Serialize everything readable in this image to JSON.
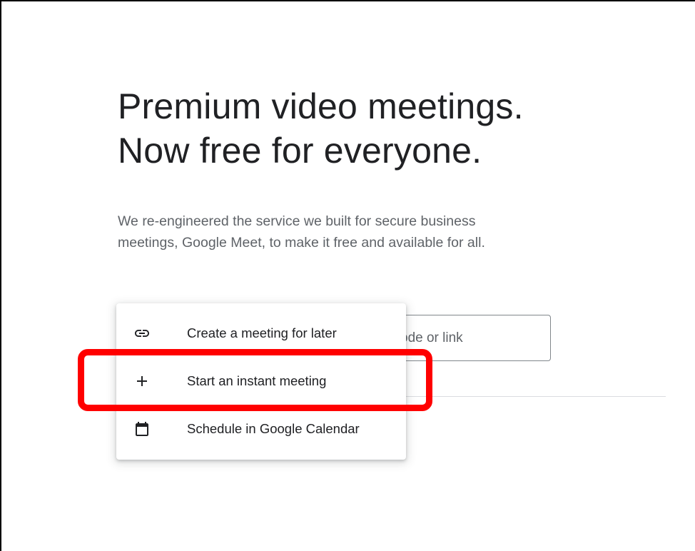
{
  "hero": {
    "headline_line1": "Premium video meetings.",
    "headline_line2": "Now free for everyone.",
    "subtitle_line1": "We re-engineered the service we built for secure business",
    "subtitle_line2": "meetings, Google Meet, to make it free and available for all."
  },
  "join": {
    "placeholder_visible": "ode or link"
  },
  "new_meeting_menu": {
    "items": [
      {
        "label": "Create a meeting for later",
        "icon": "link-icon"
      },
      {
        "label": "Start an instant meeting",
        "icon": "plus-icon"
      },
      {
        "label": "Schedule in Google Calendar",
        "icon": "calendar-icon"
      }
    ]
  },
  "annotation": {
    "highlight_color": "#ff0000",
    "highlighted_item": "Start an instant meeting"
  },
  "colors": {
    "headline": "#202124",
    "subtitle": "#5f6368",
    "divider": "#dadce0"
  }
}
